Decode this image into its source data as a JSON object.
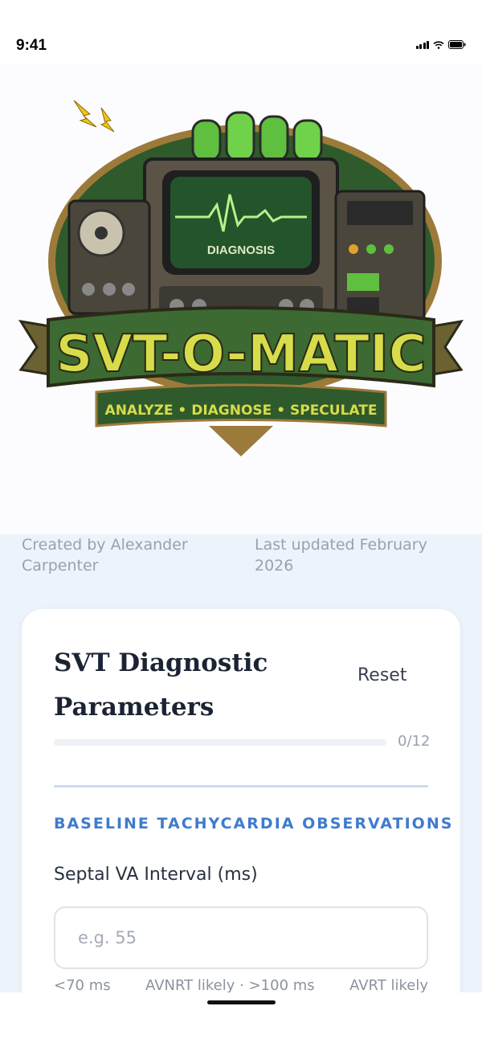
{
  "status_bar": {
    "time": "9:41"
  },
  "hero": {
    "logo_title": "SVT-O-MATIC",
    "logo_tagline": "ANALYZE • DIAGNOSE • SPECULATE",
    "logo_screen_label": "DIAGNOSIS"
  },
  "meta": {
    "author": "Created by Alexander Carpenter",
    "updated": "Last updated February 2026"
  },
  "card": {
    "title": "SVT Diagnostic Parameters",
    "reset_label": "Reset",
    "progress": {
      "count_label": "0/12",
      "fraction": 0
    },
    "section_heading": "BASELINE TACHYCARDIA OBSERVATIONS",
    "field": {
      "label": "Septal VA Interval (ms)",
      "placeholder": "e.g. 55",
      "value": "",
      "hints": [
        "<70 ms",
        "AVNRT likely · >100 ms",
        "AVRT likely"
      ]
    }
  },
  "colors": {
    "accent": "#3f7bcd",
    "logo_green": "#2f5a2c",
    "logo_yellow": "#d7dc4a",
    "background": "#edf3fb"
  }
}
